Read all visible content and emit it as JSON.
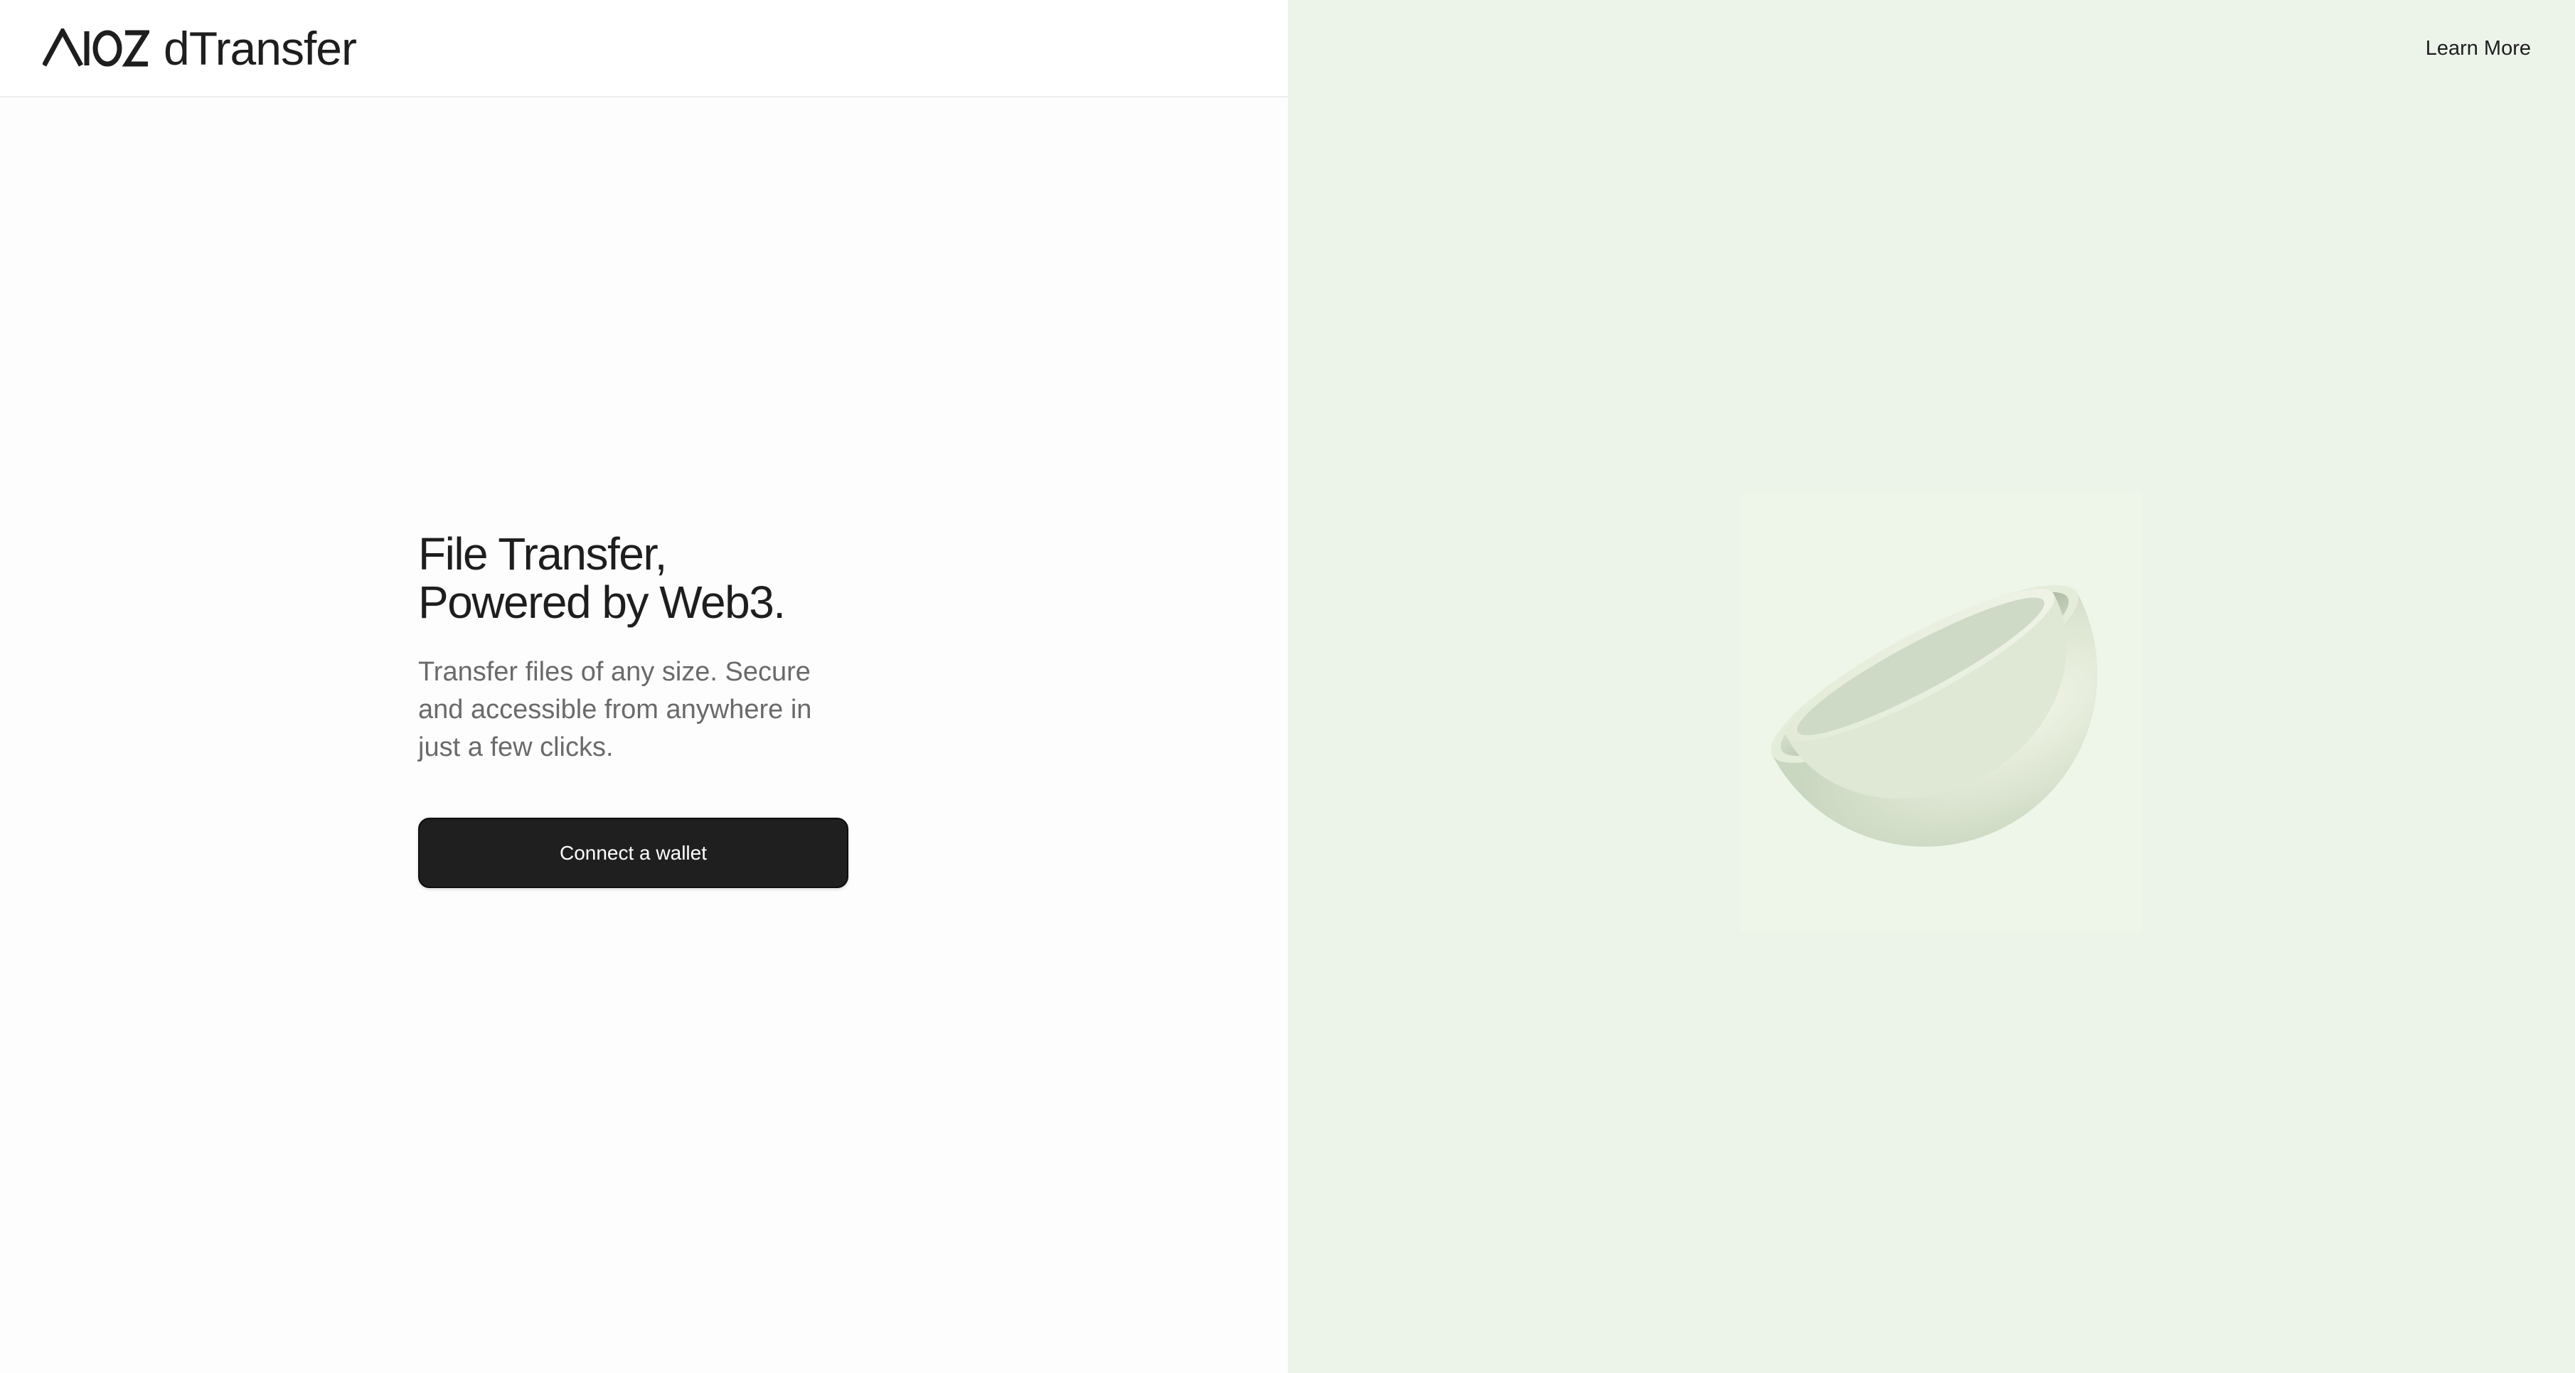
{
  "header": {
    "logo_brand": "AIOZ",
    "logo_product": "dTransfer",
    "learn_more_label": "Learn More"
  },
  "hero": {
    "title": "File Transfer, Powered by Web3.",
    "subtitle": "Transfer files of any size. Secure and accessible from anywhere in just a few clicks.",
    "connect_label": "Connect a wallet"
  },
  "colors": {
    "left_background": "#fdfdfd",
    "right_background": "#ecf4ea",
    "button_background": "#1f1f1f",
    "button_text": "#ffffff",
    "title_text": "#1e1e1e",
    "subtitle_text": "#6a6a6a"
  },
  "icons": {
    "brand_mark": "aioz-logo-icon",
    "illustration": "nested-bowls-illustration"
  }
}
